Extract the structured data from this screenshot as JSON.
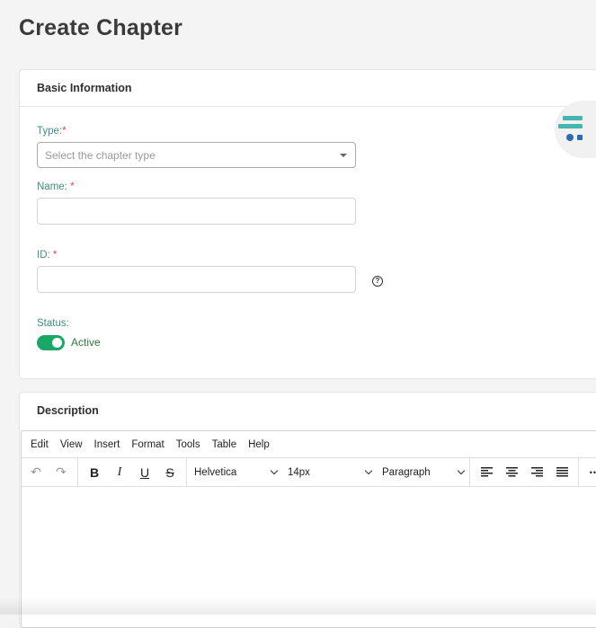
{
  "page": {
    "title": "Create Chapter"
  },
  "basic_info": {
    "header": "Basic Information",
    "type": {
      "label": "Type:",
      "required": "*",
      "placeholder": "Select the chapter type"
    },
    "name": {
      "label": "Name:",
      "required": "*",
      "value": ""
    },
    "id": {
      "label": "ID:",
      "required": "*",
      "value": "",
      "help_icon": "question-circle-icon"
    },
    "status": {
      "label": "Status:",
      "toggle_label": "Active",
      "enabled": true
    }
  },
  "description": {
    "header": "Description",
    "menu": [
      "Edit",
      "View",
      "Insert",
      "Format",
      "Tools",
      "Table",
      "Help"
    ],
    "toolbar": {
      "undo_icon": "↶",
      "redo_icon": "↷",
      "bold": "B",
      "italic": "I",
      "underline": "U",
      "strike": "S",
      "font_family": "Helvetica",
      "font_size": "14px",
      "block_format": "Paragraph",
      "more": "•••"
    }
  },
  "colors": {
    "label_teal": "#3f8f7e",
    "required_red": "#e0463c",
    "toggle_green": "#1aa866",
    "active_text": "#2d7a3a"
  }
}
